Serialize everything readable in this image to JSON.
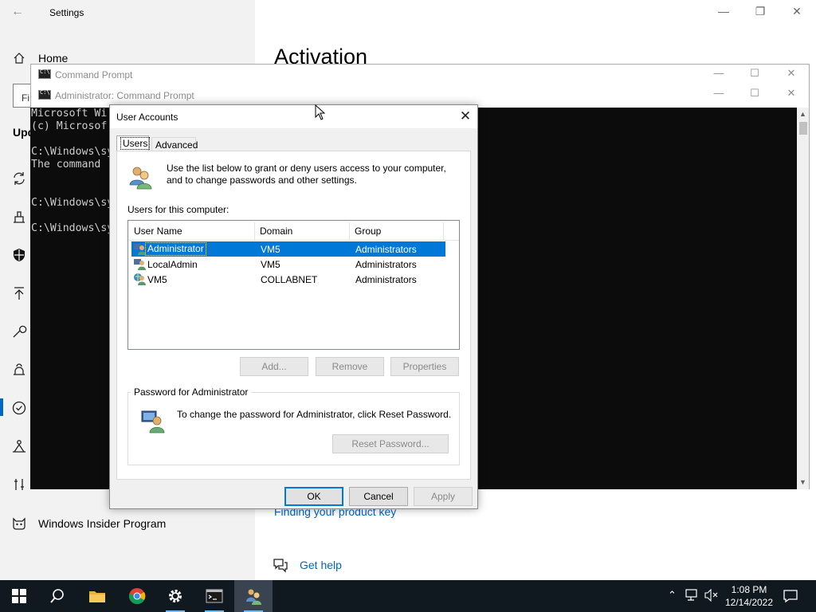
{
  "settings": {
    "title": "Settings",
    "home": "Home",
    "search_placeholder": "Fi",
    "section_label": "Upd",
    "page_title": "Activation",
    "product_key_link": "Finding your product key",
    "get_help": "Get help",
    "insider": "Windows Insider Program"
  },
  "cmd_back": {
    "title": "Command Prompt"
  },
  "cmd_front": {
    "title": "Administrator: Command Prompt",
    "lines": [
      "Microsoft Wi",
      "(c) Microsof",
      "",
      "C:\\Windows\\sy",
      "The command ",
      "",
      "",
      "C:\\Windows\\sy",
      "",
      "C:\\Windows\\sy"
    ]
  },
  "dialog": {
    "title": "User Accounts",
    "tabs": [
      "Users",
      "Advanced"
    ],
    "intro": "Use the list below to grant or deny users access to your computer, and to change passwords and other settings.",
    "list_label": "Users for this computer:",
    "columns": [
      "User Name",
      "Domain",
      "Group"
    ],
    "rows": [
      {
        "user": "Administrator",
        "domain": "VM5",
        "group": "Administrators",
        "selected": true
      },
      {
        "user": "LocalAdmin",
        "domain": "VM5",
        "group": "Administrators",
        "selected": false
      },
      {
        "user": "VM5",
        "domain": "COLLABNET",
        "group": "Administrators",
        "selected": false
      }
    ],
    "buttons": {
      "add": "Add...",
      "remove": "Remove",
      "properties": "Properties"
    },
    "password_group": "Password for Administrator",
    "password_text": "To change the password for Administrator, click Reset Password.",
    "reset_password": "Reset Password...",
    "ok": "OK",
    "cancel": "Cancel",
    "apply": "Apply"
  },
  "taskbar": {
    "time": "1:08 PM",
    "date": "12/14/2022",
    "apps": [
      "start-icon",
      "search-icon",
      "file-explorer-icon",
      "chrome-icon",
      "settings-icon",
      "command-prompt-icon",
      "user-accounts-icon"
    ]
  },
  "colors": {
    "accent": "#0078d7",
    "taskbar": "#101820",
    "console": "#0c0c0c",
    "link": "#0067c0"
  }
}
